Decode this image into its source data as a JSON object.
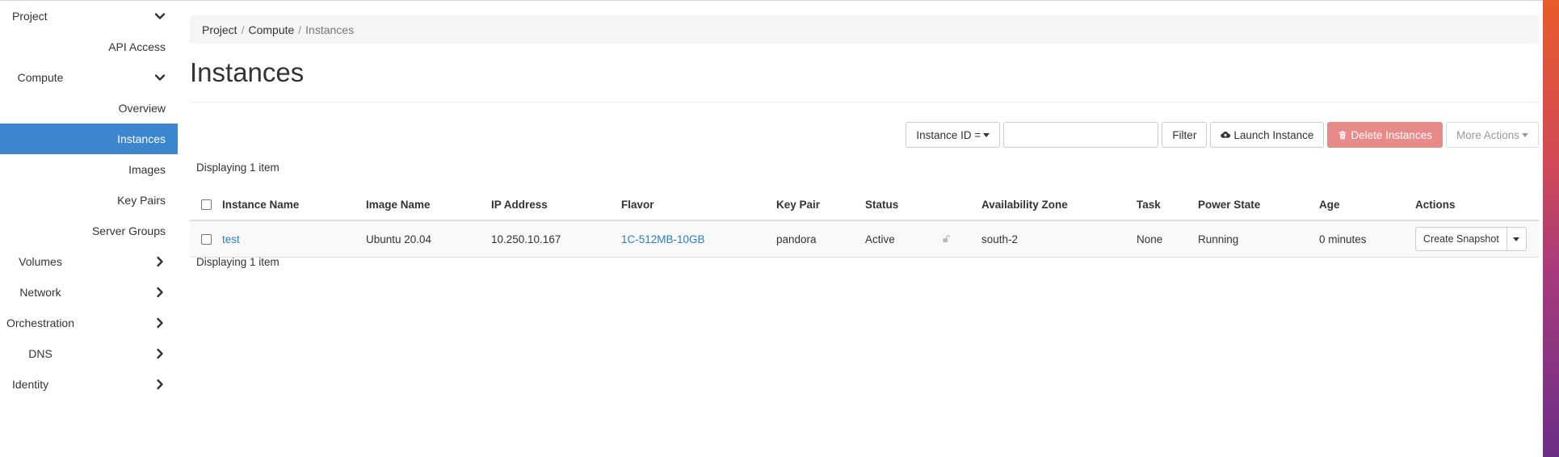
{
  "sidebar": {
    "project": "Project",
    "api_access": "API Access",
    "compute": "Compute",
    "overview": "Overview",
    "instances": "Instances",
    "images": "Images",
    "key_pairs": "Key Pairs",
    "server_groups": "Server Groups",
    "volumes": "Volumes",
    "network": "Network",
    "orchestration": "Orchestration",
    "dns": "DNS",
    "identity": "Identity"
  },
  "breadcrumb": {
    "project": "Project",
    "compute": "Compute",
    "instances": "Instances",
    "separator": "/"
  },
  "page": {
    "title": "Instances"
  },
  "toolbar": {
    "filter_field": "Instance ID =",
    "filter_value": "",
    "filter_button": "Filter",
    "launch_button": "Launch Instance",
    "delete_button": "Delete Instances",
    "more_actions": "More Actions"
  },
  "table": {
    "count_top": "Displaying 1 item",
    "count_bottom": "Displaying 1 item",
    "headers": {
      "name": "Instance Name",
      "image": "Image Name",
      "ip": "IP Address",
      "flavor": "Flavor",
      "key_pair": "Key Pair",
      "status": "Status",
      "az": "Availability Zone",
      "task": "Task",
      "power": "Power State",
      "age": "Age",
      "actions": "Actions"
    },
    "rows": [
      {
        "name": "test",
        "image": "Ubuntu 20.04",
        "ip": "10.250.10.167",
        "flavor": "1C-512MB-10GB",
        "key_pair": "pandora",
        "status": "Active",
        "az": "south-2",
        "task": "None",
        "power": "Running",
        "age": "0 minutes",
        "action": "Create Snapshot"
      }
    ]
  },
  "colors": {
    "active_nav": "#3c86ce",
    "link": "#2a7ec2",
    "danger_button": "#e88b88"
  },
  "icons": {
    "expanded": "chevron-down-icon",
    "collapsed": "chevron-right-icon",
    "launch": "cloud-upload-icon",
    "delete": "trash-icon",
    "status_lock": "unlock-icon"
  }
}
